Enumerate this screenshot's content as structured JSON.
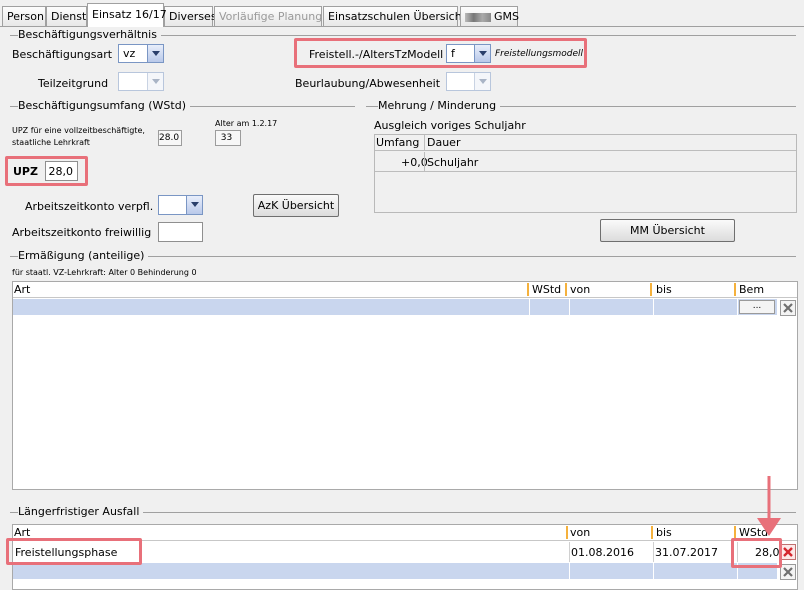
{
  "tabs": [
    {
      "label": "Person",
      "state": "normal"
    },
    {
      "label": "Dienst",
      "state": "normal"
    },
    {
      "label": "Einsatz 16/17",
      "state": "active"
    },
    {
      "label": "Diverses",
      "state": "normal"
    },
    {
      "label": "Vorläufige Planung",
      "state": "disabled"
    },
    {
      "label": "Einsatzschulen Übersicht",
      "state": "normal"
    },
    {
      "label": "GMS",
      "state": "normal"
    }
  ],
  "employment": {
    "section_title": "Beschäftigungsverhältnis",
    "type_label": "Beschäftigungsart",
    "type_value": "vz",
    "part_time_label": "Teilzeitgrund",
    "part_time_value": "",
    "release_label": "Freistell.-/AltersTzModell",
    "release_value": "f",
    "release_text": "Freistellungsmodell",
    "leave_label": "Beurlaubung/Abwesenheit",
    "leave_value": ""
  },
  "scope": {
    "section_title": "Beschäftigungsumfang (WStd)",
    "upz_full_label_1": "UPZ für eine vollzeitbeschäftigte,",
    "upz_full_label_2": "staatliche Lehrkraft",
    "upz_full_value": "28.0",
    "age_label": "Alter am 1.2.17",
    "age_value": "33",
    "upz_label": "UPZ",
    "upz_value": "28,0",
    "azk_label": "Arbeitszeitkonto verpfl.",
    "azk_value": "",
    "azk_button": "AzK Übersicht",
    "azk_voluntary_label": "Arbeitszeitkonto freiwillig",
    "azk_voluntary_value": ""
  },
  "extra": {
    "section_title": "Mehrung / Minderung",
    "subtitle": "Ausgleich voriges Schuljahr",
    "col_amount": "Umfang",
    "col_duration": "Dauer",
    "row_amount": "+0,0",
    "row_duration": "Schuljahr",
    "button": "MM Übersicht"
  },
  "reduction": {
    "section_title": "Ermäßigung (anteilige)",
    "note": "für staatl. VZ-Lehrkraft: Alter 0 Behinderung 0",
    "columns": [
      "Art",
      "WStd",
      "von",
      "bis",
      "Bem"
    ],
    "ellipsis": "..."
  },
  "absence": {
    "section_title": "Längerfristiger Ausfall",
    "columns": [
      "Art",
      "von",
      "bis",
      "WStd"
    ],
    "rows": [
      {
        "art": "Freistellungsphase",
        "von": "01.08.2016",
        "bis": "31.07.2017",
        "wstd": "28,0"
      }
    ]
  },
  "colors": {
    "highlight": "#e8707a",
    "selected_row": "#c9d6ee",
    "column_separator": "#f5b13c"
  }
}
